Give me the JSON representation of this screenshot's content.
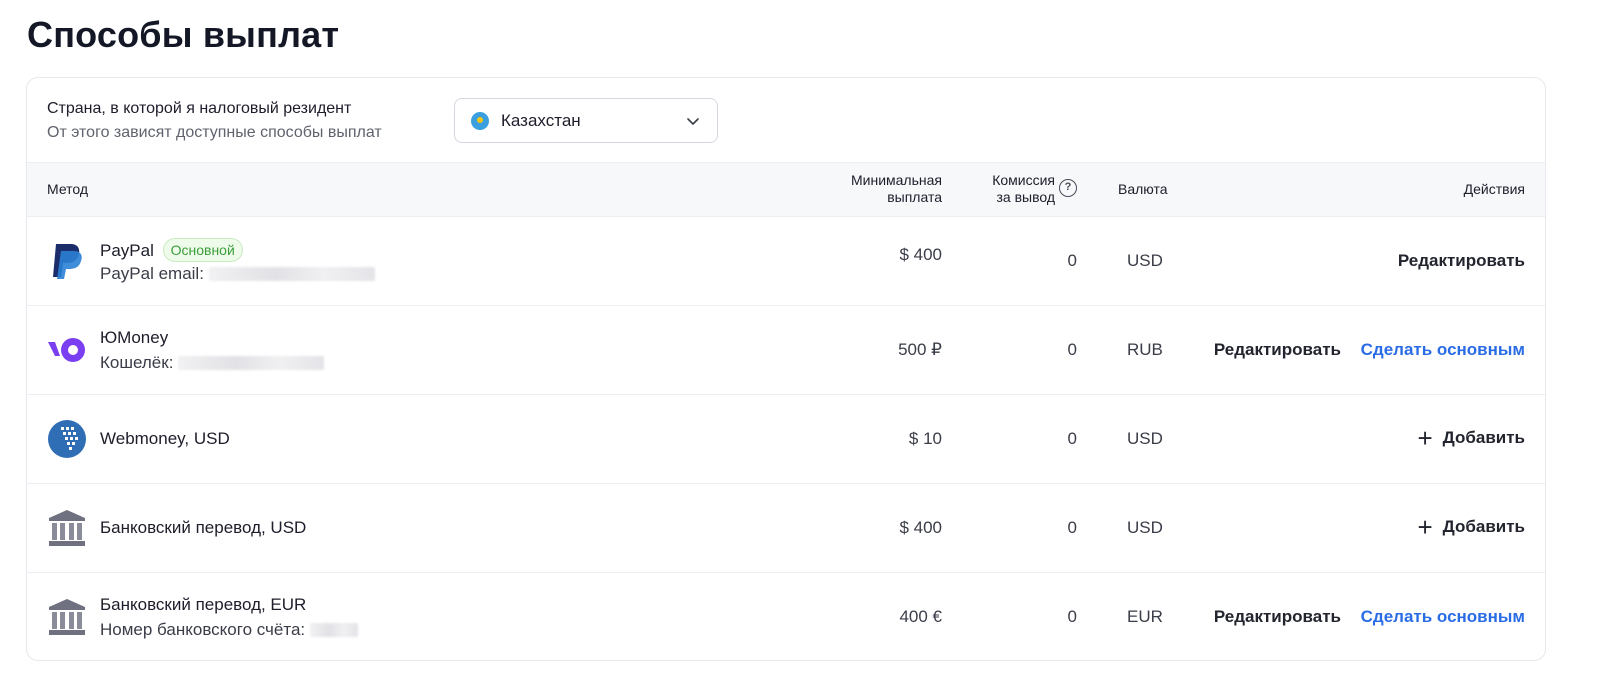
{
  "page": {
    "title": "Способы выплат"
  },
  "country": {
    "title": "Страна, в которой я налоговый резидент",
    "subtitle": "От этого зависят доступные способы выплат",
    "selected": "Казахстан"
  },
  "table": {
    "headers": {
      "method": "Метод",
      "min_line1": "Минимальная",
      "min_line2": "выплата",
      "fee_line1": "Комиссия",
      "fee_line2": "за вывод",
      "fee_help": "?",
      "currency": "Валюта",
      "actions": "Действия"
    },
    "rows": [
      {
        "name": "PayPal",
        "badge": "Основной",
        "detail": "PayPal email:",
        "min": "$ 400",
        "fee": "0",
        "currency": "USD",
        "edit": "Редактировать"
      },
      {
        "name": "ЮMoney",
        "detail": "Кошелёк:",
        "min": "500 ₽",
        "fee": "0",
        "currency": "RUB",
        "edit": "Редактировать",
        "make_main": "Сделать основным"
      },
      {
        "name": "Webmoney, USD",
        "min": "$ 10",
        "fee": "0",
        "currency": "USD",
        "add": "Добавить"
      },
      {
        "name": "Банковский перевод, USD",
        "min": "$ 400",
        "fee": "0",
        "currency": "USD",
        "add": "Добавить"
      },
      {
        "name": "Банковский перевод, EUR",
        "detail": "Номер банковского счёта:",
        "min": "400 €",
        "fee": "0",
        "currency": "EUR",
        "edit": "Редактировать",
        "make_main": "Сделать основным"
      }
    ]
  },
  "colors": {
    "accent": "#2a6ce6",
    "badge_green": "#3b9e3b",
    "paypal_dark": "#1b2d6b",
    "paypal_light": "#2a7fd4",
    "yoomoney": "#7b3ff2",
    "webmoney": "#2f6db5",
    "bank": "#6f7180"
  }
}
